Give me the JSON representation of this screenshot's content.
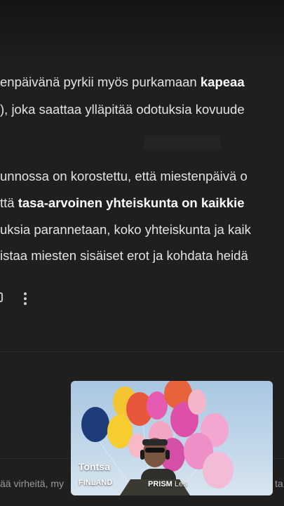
{
  "article": {
    "line1_pre": "enpäivänä pyrkii myös purkamaan ",
    "line1_bold": "kapeaa",
    "line2": "), joka saattaa ylläpitää odotuksia kovuude",
    "line3": "unnossa on korostettu, että miestenpäivä o",
    "line4_pre": "ttä ",
    "line4_bold": "tasa-arvoinen yhteiskunta on kaikkie",
    "line5": "uksia parannetaan, koko yhteiskunta ja kaik",
    "line6": "istaa miesten sisäiset erot ja kohdata heidä"
  },
  "footer": {
    "disclaimer_left": "ää virheitä, my",
    "disclaimer_right": "ta"
  },
  "pip": {
    "name": "Tontsa",
    "country": "FINLAND",
    "brand": "PRISM",
    "brand_suffix": "Les"
  }
}
